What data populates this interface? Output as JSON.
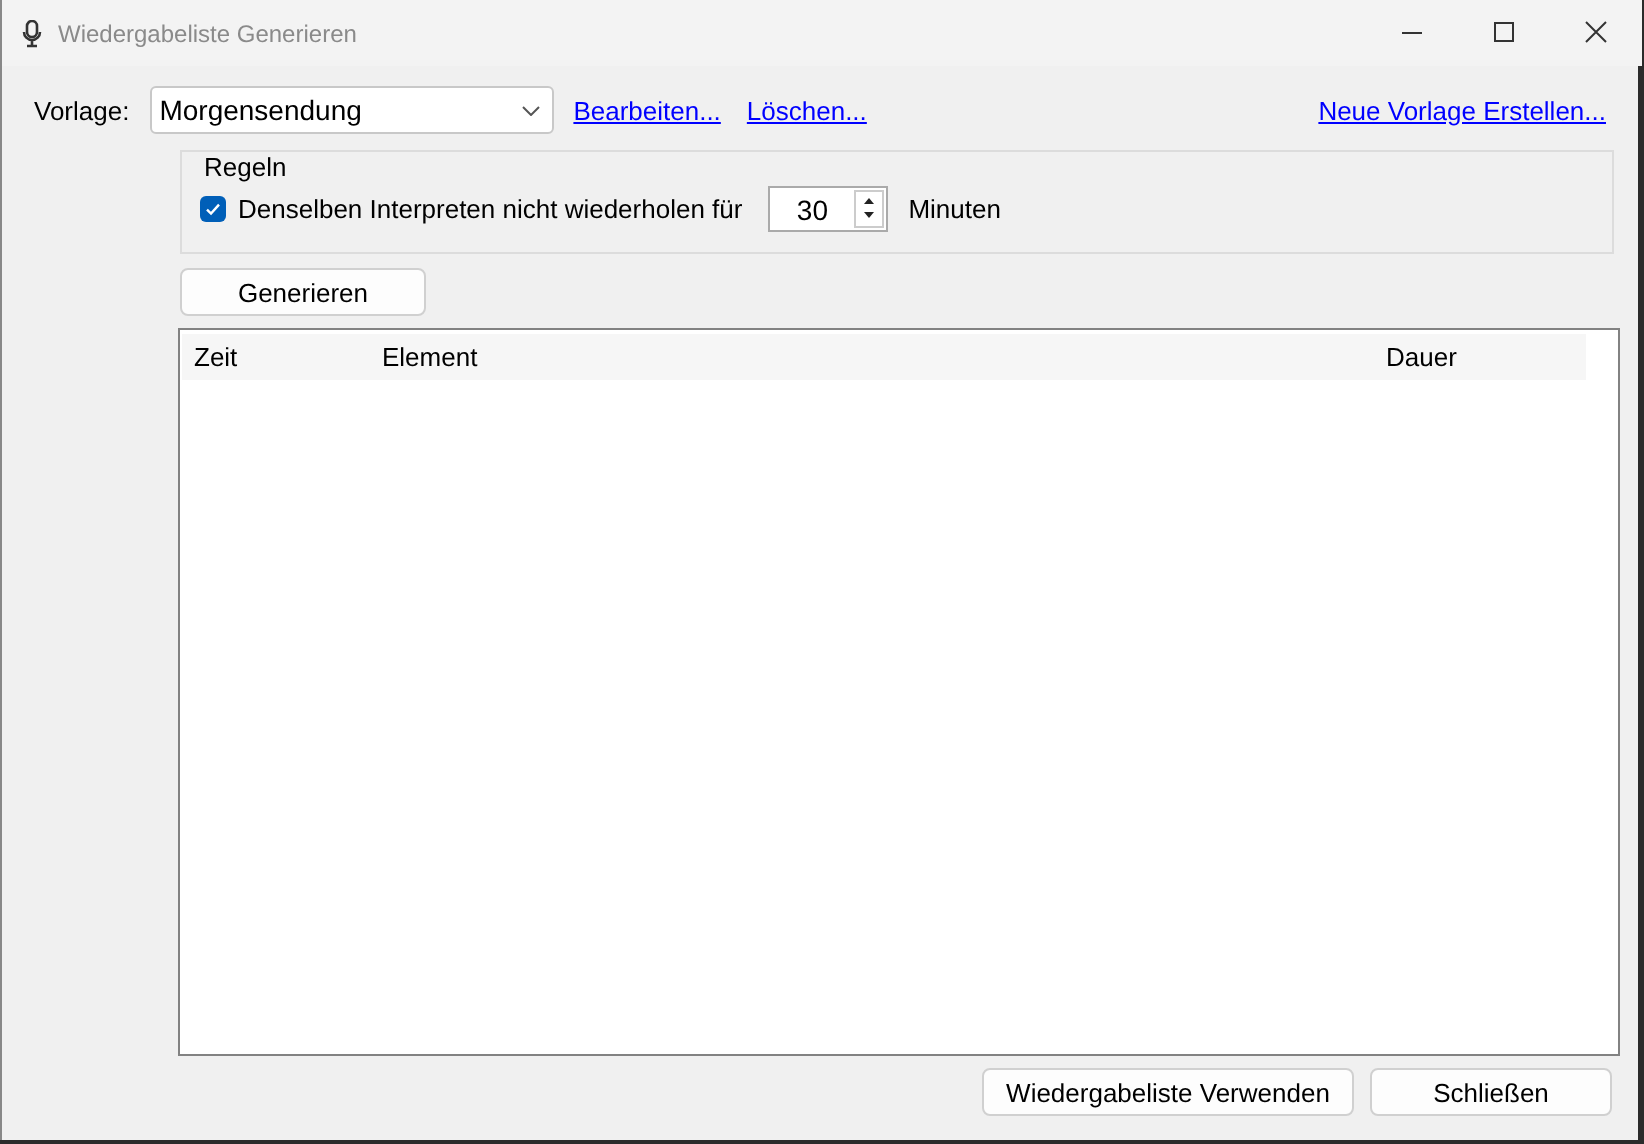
{
  "window": {
    "title": "Wiedergabeliste Generieren"
  },
  "template": {
    "label": "Vorlage:",
    "value": "Morgensendung"
  },
  "links": [
    "Bearbeiten...",
    "Löschen..."
  ],
  "new_template_link": "Neue Vorlage Erstellen...",
  "rules": {
    "title": "Regeln",
    "checkbox": {
      "label": "Denselben Interpreten nicht wiederholen für",
      "checked": true
    },
    "minutes": {
      "value": "30",
      "unit": "Minuten"
    }
  },
  "generate_button": "Generieren",
  "table": {
    "columns": [
      "Zeit",
      "Element",
      "Dauer"
    ]
  },
  "buttons": [
    "Wiedergabeliste Verwenden",
    "Schließen"
  ]
}
